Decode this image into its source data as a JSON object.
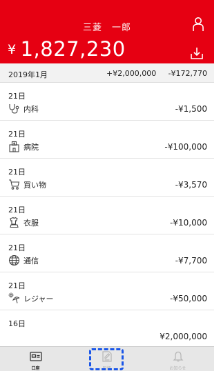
{
  "header": {
    "user_name": "三菱　一郎",
    "currency_symbol": "¥",
    "balance": "1,827,230",
    "accent_color": "#e60012"
  },
  "month_summary": {
    "label": "2019年1月",
    "income": "+¥2,000,000",
    "expense": "-¥172,770"
  },
  "transactions": [
    {
      "date": "21日",
      "icon": "stethoscope-icon",
      "category": "内科",
      "amount": "-¥1,500"
    },
    {
      "date": "21日",
      "icon": "hospital-icon",
      "category": "病院",
      "amount": "-¥100,000"
    },
    {
      "date": "21日",
      "icon": "shopping-cart-icon",
      "category": "買い物",
      "amount": "-¥3,570"
    },
    {
      "date": "21日",
      "icon": "clothing-icon",
      "category": "衣服",
      "amount": "-¥10,000"
    },
    {
      "date": "21日",
      "icon": "globe-icon",
      "category": "通信",
      "amount": "-¥7,700"
    },
    {
      "date": "21日",
      "icon": "leisure-icon",
      "category": "レジャー",
      "amount": "-¥50,000"
    },
    {
      "date": "16日",
      "icon": "",
      "category": "",
      "amount": "¥2,000,000"
    }
  ],
  "tabbar": {
    "tabs": [
      {
        "label": "口座",
        "icon": "card-icon",
        "active": true
      },
      {
        "label": "明細",
        "icon": "document-edit-icon",
        "active": false
      },
      {
        "label": "お知らせ",
        "icon": "bell-icon",
        "active": false
      }
    ]
  }
}
